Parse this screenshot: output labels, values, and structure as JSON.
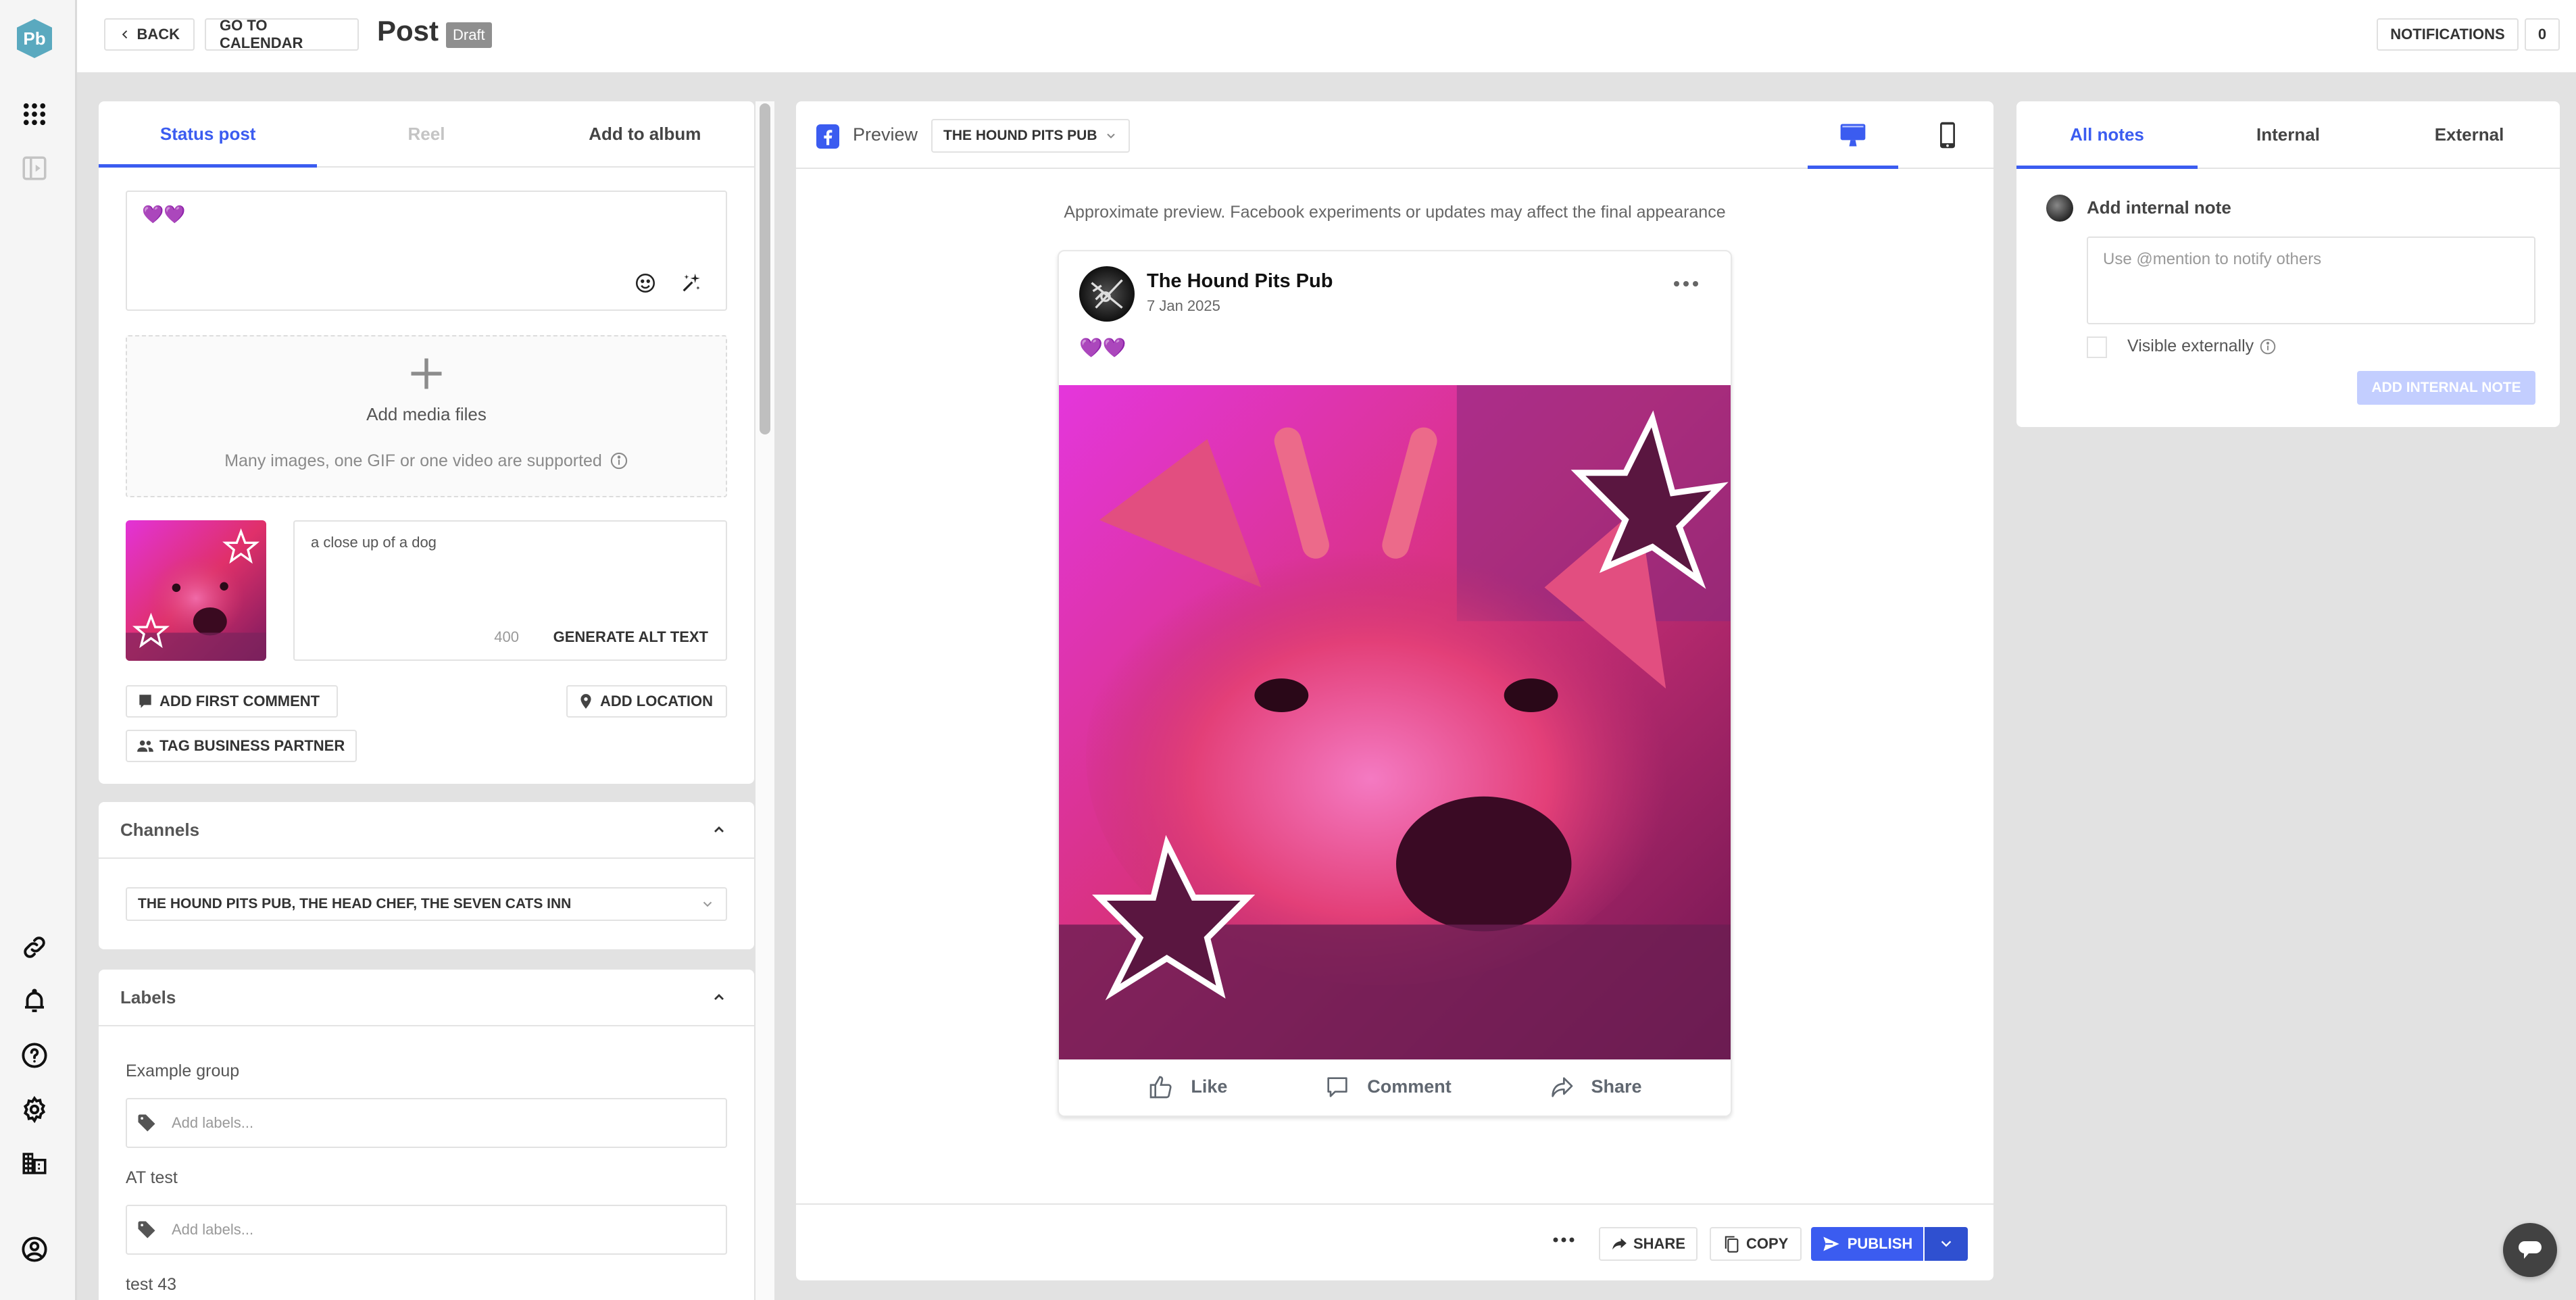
{
  "app": {
    "logo_text": "Pb"
  },
  "sidebar": {
    "top_icons": [
      "apps-grid-icon",
      "collapse-panel-icon"
    ],
    "bottom_icons": [
      "link-icon",
      "bell-icon",
      "help-icon",
      "settings-icon",
      "buildings-icon",
      "account-icon"
    ]
  },
  "topbar": {
    "back_label": "BACK",
    "calendar_label": "GO TO CALENDAR",
    "title": "Post",
    "status_badge": "Draft",
    "notifications_label": "NOTIFICATIONS",
    "notifications_count": "0"
  },
  "editor": {
    "tabs": [
      {
        "label": "Status post",
        "state": "active"
      },
      {
        "label": "Reel",
        "state": "disabled"
      },
      {
        "label": "Add to album",
        "state": "normal"
      }
    ],
    "post_text": "💜💜",
    "dropzone": {
      "title": "Add media files",
      "subtitle": "Many images, one GIF or one video are supported"
    },
    "media": {
      "alt_text": "a close up of a dog",
      "alt_remaining": "400",
      "generate_alt_label": "GENERATE ALT TEXT"
    },
    "actions": {
      "first_comment": "ADD FIRST COMMENT",
      "location": "ADD LOCATION",
      "business_partner": "TAG BUSINESS PARTNER"
    }
  },
  "channels": {
    "title": "Channels",
    "selected": "THE HOUND PITS PUB, THE HEAD CHEF, THE SEVEN CATS INN"
  },
  "labels": {
    "title": "Labels",
    "groups": [
      {
        "name": "Example group",
        "placeholder": "Add labels..."
      },
      {
        "name": "AT test",
        "placeholder": "Add labels..."
      },
      {
        "name": "test 43"
      }
    ]
  },
  "preview": {
    "label": "Preview",
    "account": "THE HOUND PITS PUB",
    "devices": [
      {
        "name": "desktop",
        "active": true
      },
      {
        "name": "mobile",
        "active": false
      }
    ],
    "disclaimer": "Approximate preview. Facebook experiments or updates may affect the final appearance",
    "post": {
      "page_name": "The Hound Pits Pub",
      "date": "7 Jan 2025",
      "text": "💜💜",
      "image_description": "a close up of a dog",
      "actions": [
        "Like",
        "Comment",
        "Share"
      ]
    },
    "footer": {
      "share_label": "SHARE",
      "copy_label": "COPY",
      "publish_label": "PUBLISH"
    }
  },
  "notes": {
    "tabs": [
      {
        "label": "All notes",
        "state": "active"
      },
      {
        "label": "Internal",
        "state": "normal"
      },
      {
        "label": "External",
        "state": "normal"
      }
    ],
    "title": "Add internal note",
    "placeholder": "Use @mention to notify others",
    "visible_externally_label": "Visible externally",
    "visible_externally_checked": false,
    "submit_label": "ADD INTERNAL NOTE"
  },
  "colors": {
    "accent": "#3b5cf0",
    "accent_dark": "#2f50d0",
    "logo": "#5aa9bf",
    "disabled_button": "#c3ceff"
  }
}
